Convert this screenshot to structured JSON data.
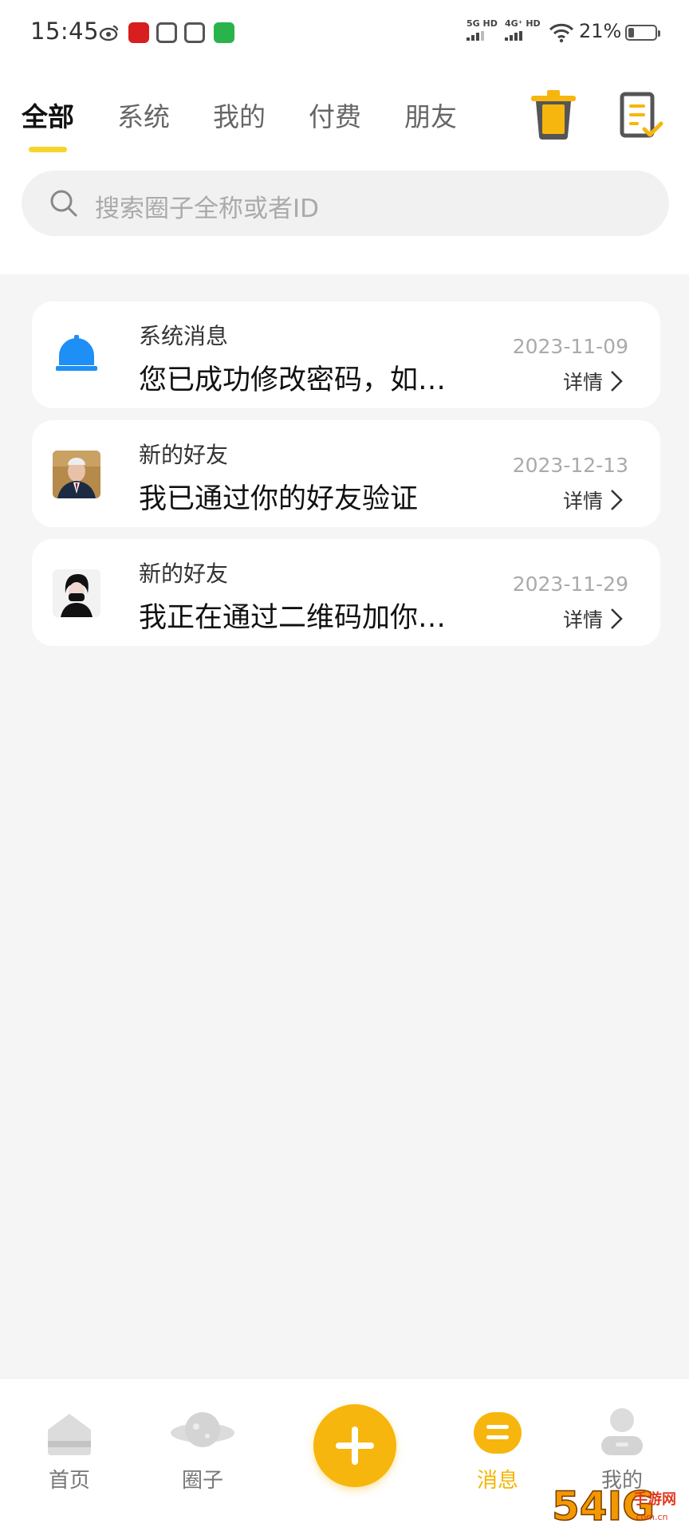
{
  "status_bar": {
    "time": "15:45",
    "net1": "5G HD",
    "net2": "4G⁺ HD",
    "battery": "21%",
    "battery_level": 0.21,
    "icons": [
      "weibo-icon",
      "red-app-icon",
      "grey-app-icon",
      "grey-app-icon-2",
      "wechat-icon",
      "wifi-icon",
      "battery-icon"
    ]
  },
  "tabs": [
    "全部",
    "系统",
    "我的",
    "付费",
    "朋友"
  ],
  "active_tab": 0,
  "search": {
    "placeholder": "搜索圈子全称或者ID"
  },
  "messages": [
    {
      "type": "系统消息",
      "text": "您已成功修改密码，如…",
      "date": "2023-11-09",
      "detail": "详情",
      "avatar": "bell-icon"
    },
    {
      "type": "新的好友",
      "text": "我已通过你的好友验证",
      "date": "2023-12-13",
      "detail": "详情",
      "avatar": "user-photo"
    },
    {
      "type": "新的好友",
      "text": "我正在通过二维码加你…",
      "date": "2023-11-29",
      "detail": "详情",
      "avatar": "user-photo"
    }
  ],
  "bottom_nav": [
    {
      "label": "首页",
      "icon": "home-icon"
    },
    {
      "label": "圈子",
      "icon": "planet-icon"
    },
    {
      "label": "",
      "icon": "plus-icon"
    },
    {
      "label": "消息",
      "icon": "message-icon"
    },
    {
      "label": "我的",
      "icon": "user-icon"
    }
  ],
  "active_nav": 3,
  "colors": {
    "accent": "#f7b60d",
    "tab_underline": "#f6d52a",
    "bell": "#1e8ff5"
  },
  "watermark": {
    "text": "54IG手游网",
    "sub": "www.54ig.com.cn"
  }
}
